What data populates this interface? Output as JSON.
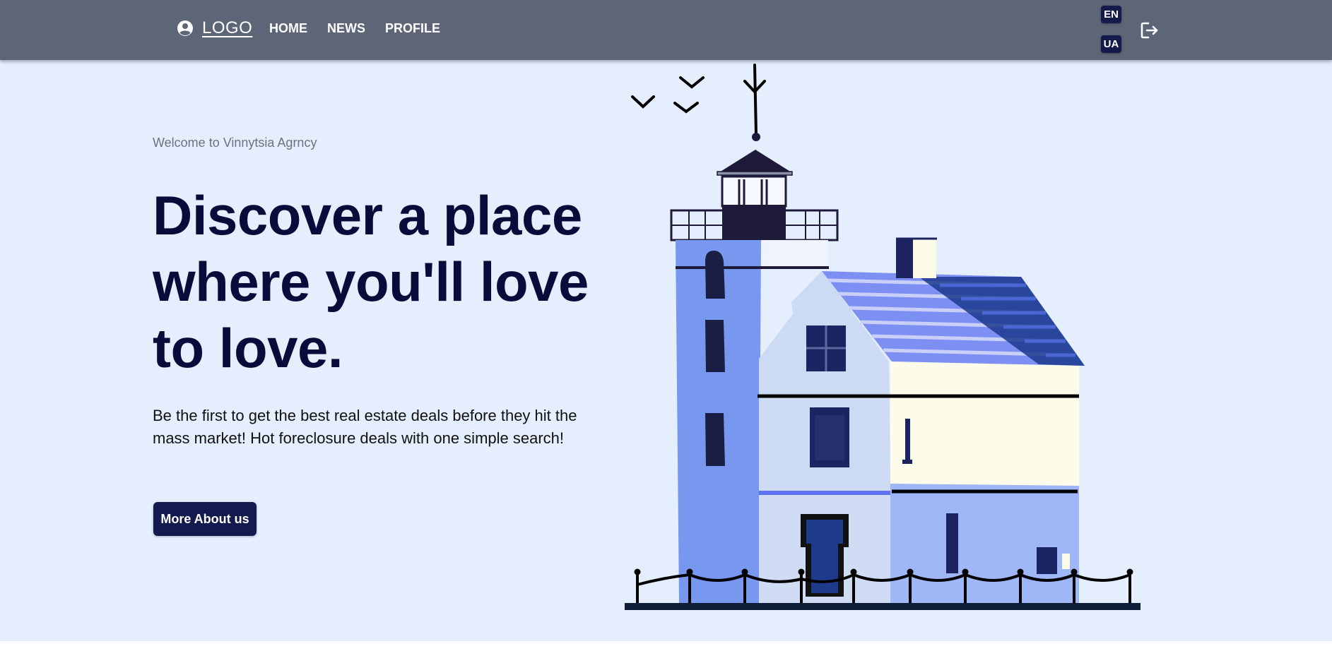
{
  "header": {
    "logo_text": "LOGO",
    "nav": [
      {
        "label": "HOME"
      },
      {
        "label": "NEWS"
      },
      {
        "label": "PROFILE"
      }
    ],
    "languages": [
      {
        "label": "EN"
      },
      {
        "label": "UA"
      }
    ],
    "icons": {
      "account": "account-circle-icon",
      "logout": "logout-icon"
    }
  },
  "hero": {
    "welcome": "Welcome to Vinnytsia Agrncy",
    "headline": "Discover a place where you'll love to love.",
    "subtext": "Be the first to get the best real estate deals before they hit the mass market! Hot foreclosure deals with one simple search!",
    "button_label": "More About us",
    "illustration": "lighthouse-house-illustration"
  },
  "colors": {
    "navbar": "#5c6677",
    "background": "#e4eefd",
    "headline": "#0b0b3b",
    "button": "#131a4d"
  }
}
